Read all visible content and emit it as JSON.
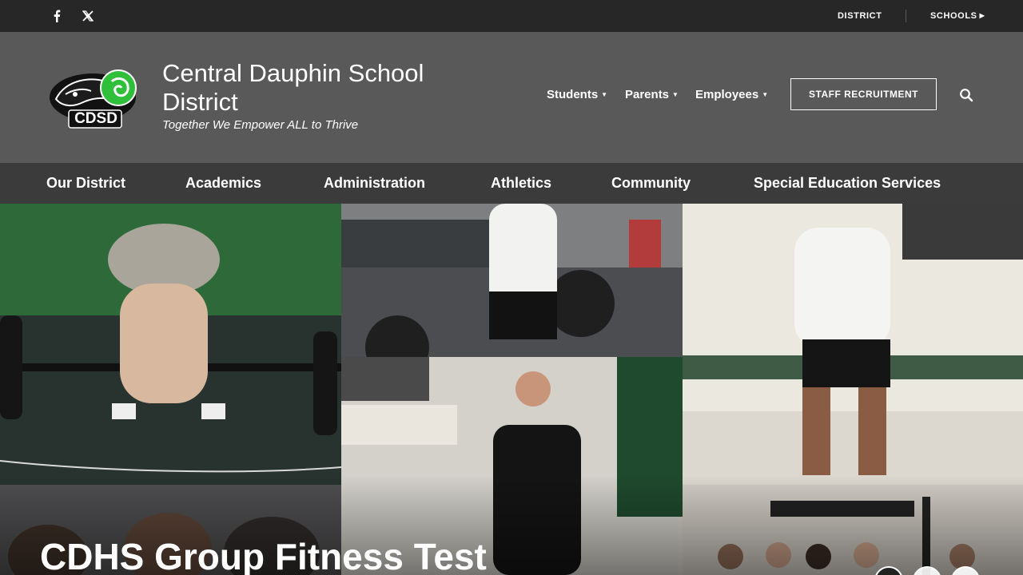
{
  "topbar": {
    "social": [
      "facebook-icon",
      "x-icon"
    ],
    "district_link": "DISTRICT",
    "schools_link": "SCHOOLS"
  },
  "header": {
    "logo_text": "CDSD",
    "title": "Central Dauphin School District",
    "tagline": "Together We Empower ALL to Thrive",
    "nav": [
      "Students",
      "Parents",
      "Employees"
    ],
    "staff_button": "STAFF RECRUITMENT"
  },
  "main_nav": [
    "Our District",
    "Academics",
    "Administration",
    "Athletics",
    "Community",
    "Special Education Services"
  ],
  "hero": {
    "title": "CDHS Group Fitness Test",
    "slides": 3,
    "active_slide": 1
  },
  "colors": {
    "topbar": "#272727",
    "header": "#595959",
    "main_nav": "#3b3b3b",
    "logo_accent": "#2fbf3a"
  }
}
